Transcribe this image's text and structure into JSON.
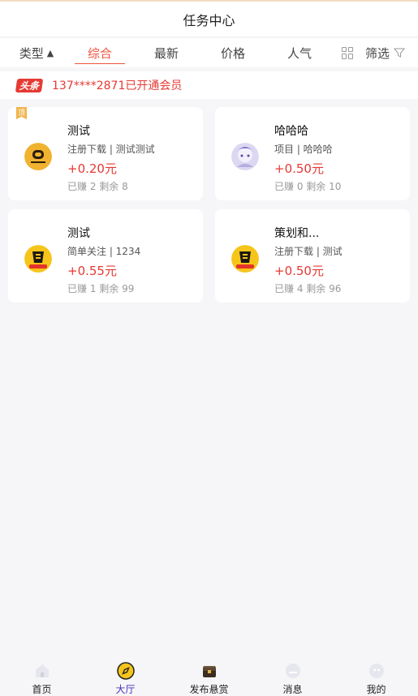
{
  "header": {
    "title": "任务中心"
  },
  "tabs": {
    "type": "类型",
    "type_arrow": "▲",
    "zonghe": "综合",
    "newest": "最新",
    "price": "价格",
    "popular": "人气",
    "filter": "筛选"
  },
  "notice": {
    "badge": "头条",
    "text": "137****2871已开通会员"
  },
  "cards": [
    {
      "pin": "顶",
      "title": "测试",
      "tags": "注册下载 | 测试测试",
      "price": "+0.20元",
      "stats": "已赚 2 剩余 8",
      "avatar": "logo-avatar"
    },
    {
      "title": "哈哈哈",
      "tags": "项目 | 哈哈哈",
      "price": "+0.50元",
      "stats": "已赚 0 剩余 10",
      "avatar": "anime-avatar"
    },
    {
      "title": "测试",
      "tags": "简单关注 | 1234",
      "price": "+0.55元",
      "stats": "已赚 1 剩余 99",
      "avatar": "reward-avatar"
    },
    {
      "title": "策划和...",
      "tags": "注册下载 | 测试",
      "price": "+0.50元",
      "stats": "已赚 4 剩余 96",
      "avatar": "reward-avatar"
    }
  ],
  "tabbar": [
    {
      "label": "首页",
      "icon": "home-icon"
    },
    {
      "label": "大厅",
      "icon": "compass-icon"
    },
    {
      "label": "发布悬赏",
      "icon": "treasure-chest-icon"
    },
    {
      "label": "消息",
      "icon": "message-icon"
    },
    {
      "label": "我的",
      "icon": "profile-icon"
    }
  ],
  "colors": {
    "accent": "#f0523b",
    "price": "#e53a33",
    "active_tab": "#4a2fbd"
  }
}
